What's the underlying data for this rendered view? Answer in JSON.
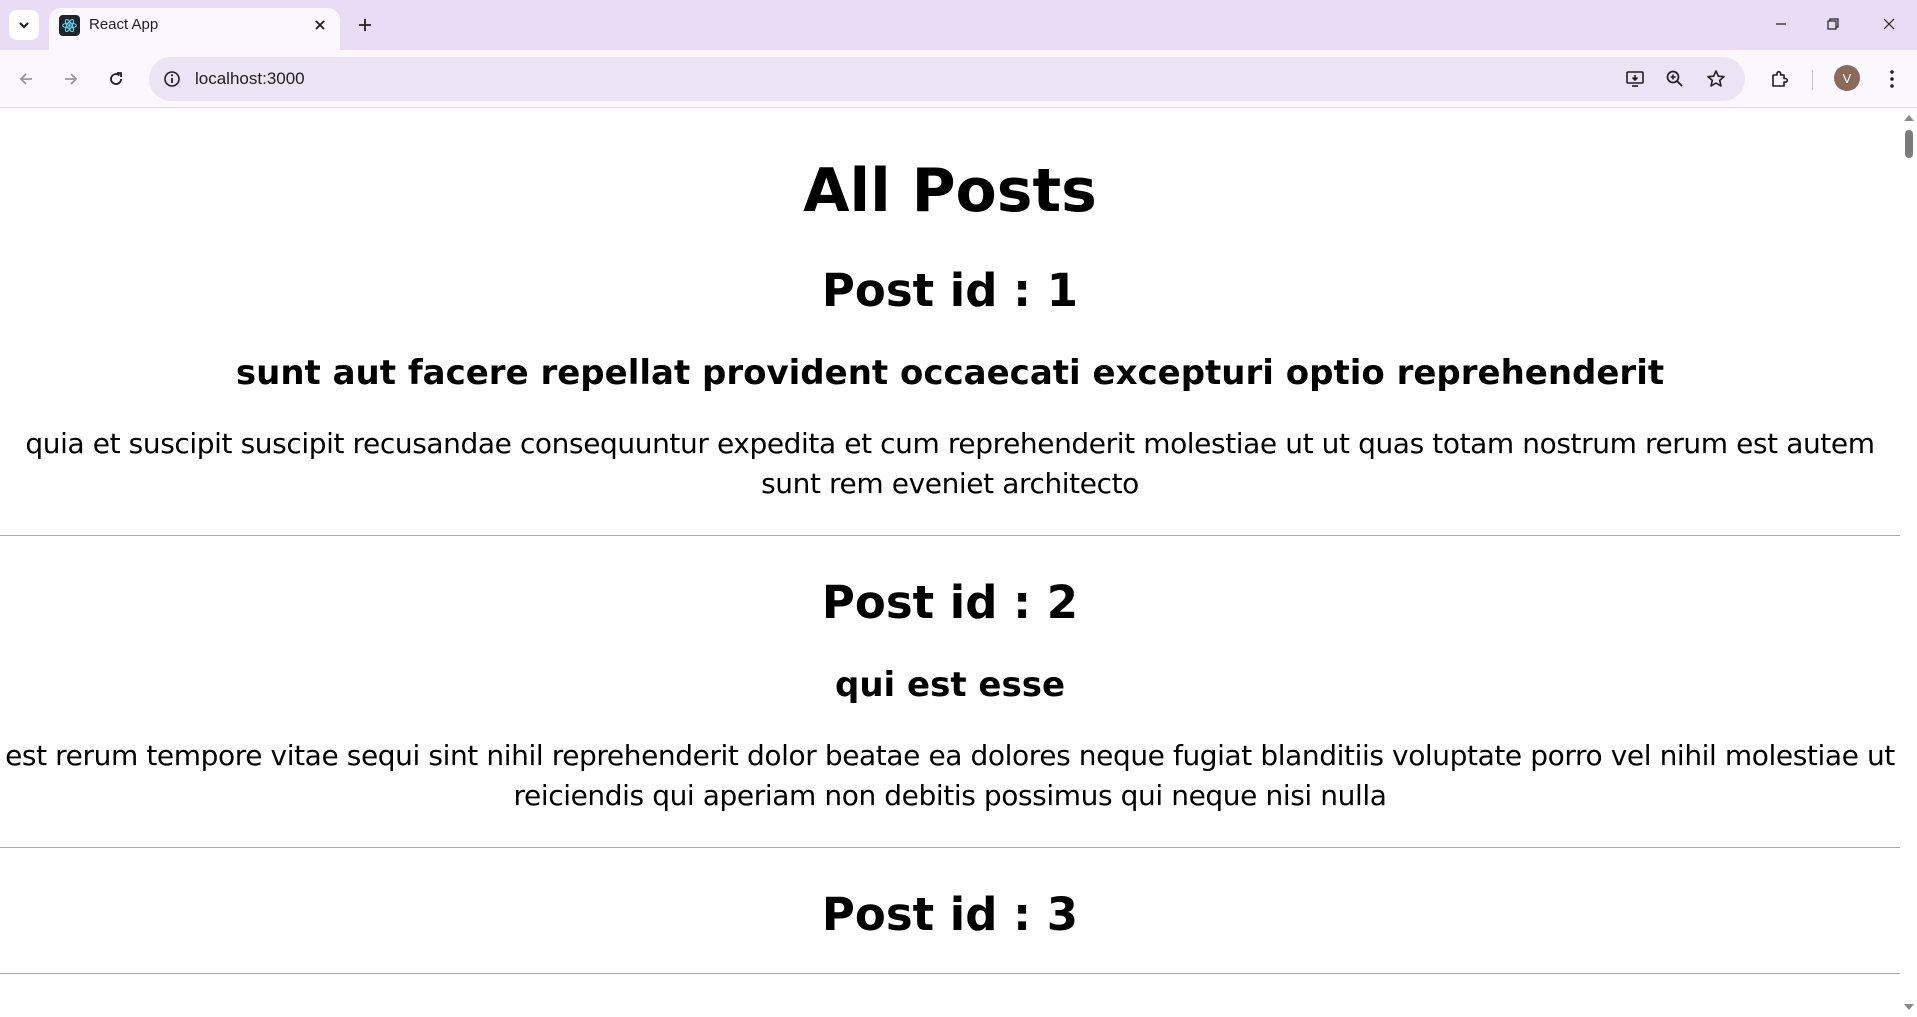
{
  "browser": {
    "tab_title": "React App",
    "url": "localhost:3000",
    "profile_initial": "V",
    "icons": {
      "tab_search": "chevron-down-icon",
      "favicon": "react-logo-icon",
      "close": "close-icon",
      "new_tab": "plus-icon",
      "back": "arrow-left-icon",
      "forward": "arrow-right-icon",
      "reload": "reload-icon",
      "site_info": "info-icon",
      "install": "install-app-icon",
      "zoom": "zoom-icon",
      "bookmark": "star-icon",
      "extensions": "puzzle-icon",
      "menu": "kebab-menu-icon"
    },
    "colors": {
      "tabstrip": "#e9ddf6",
      "toolbar": "#fbf7ff",
      "omnibox": "#ece3f5",
      "avatar": "#8c6a5a"
    }
  },
  "page": {
    "heading": "All Posts",
    "posts": [
      {
        "id_label": "Post id : 1",
        "title": "sunt aut facere repellat provident occaecati excepturi optio reprehenderit",
        "body": "quia et suscipit suscipit recusandae consequuntur expedita et cum reprehenderit molestiae ut ut quas totam nostrum rerum est autem sunt rem eveniet architecto"
      },
      {
        "id_label": "Post id : 2",
        "title": "qui est esse",
        "body": "est rerum tempore vitae sequi sint nihil reprehenderit dolor beatae ea dolores neque fugiat blanditiis voluptate porro vel nihil molestiae ut reiciendis qui aperiam non debitis possimus qui neque nisi nulla"
      },
      {
        "id_label": "Post id : 3"
      }
    ]
  }
}
